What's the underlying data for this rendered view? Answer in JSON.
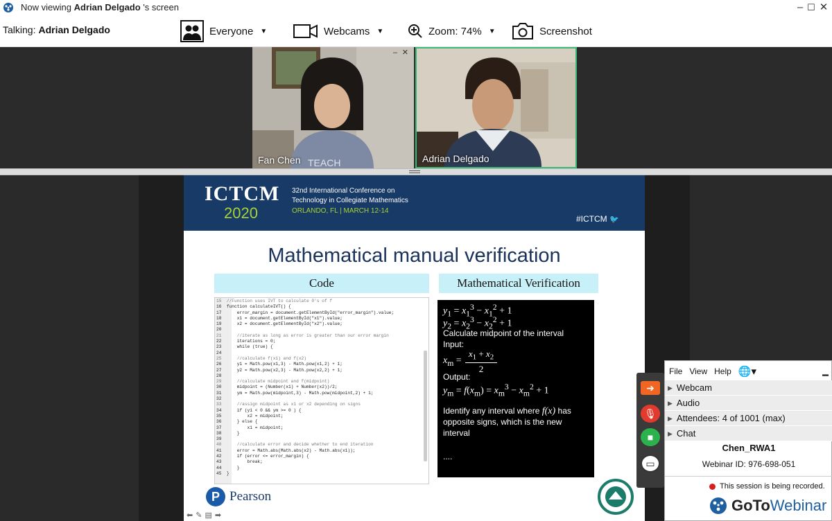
{
  "window": {
    "title_prefix": "Now viewing",
    "presenter": "Adrian Delgado",
    "title_suffix": "'s screen"
  },
  "toolbar": {
    "talking_label": "Talking:",
    "talking_name": "Adrian Delgado",
    "audience_label": "Everyone",
    "webcams_label": "Webcams",
    "zoom_label": "Zoom: 74%",
    "screenshot_label": "Screenshot"
  },
  "webcams": [
    {
      "name": "Fan Chen"
    },
    {
      "name": "Adrian Delgado"
    }
  ],
  "slide": {
    "banner": {
      "brand": "ICTCM",
      "year": "2020",
      "conference_line1": "32nd International Conference on",
      "conference_line2": "Technology in Collegiate Mathematics",
      "location": "ORLANDO, FL | MARCH 12-14",
      "hashtag": "#ICTCM"
    },
    "title": "Mathematical manual verification",
    "code_header": "Code",
    "math_header": "Mathematical Verification",
    "code_lines": [
      "15  //Function uses IVT to calculate 0's of f",
      "16  function calculateIVT() {",
      "17      error_margin = document.getElementById(\"error_margin\").value;",
      "18      x1 = document.getElementById(\"x1\").value;",
      "19      x2 = document.getElementById(\"x2\").value;",
      "20",
      "21      //iterate as long as error is greater than our error margin",
      "22      iterations = 0;",
      "23      while (true) {",
      "24",
      "25      //calculate f(x1) and f(x2)",
      "26      y1 = Math.pow(x1,3) - Math.pow(x1,2) + 1;",
      "27      y2 = Math.pow(x2,3) - Math.pow(x2,2) + 1;",
      "28",
      "29      //calculate midpoint and f(midpoint)",
      "30      midpoint = (Number(x1) + Number(x2))/2;",
      "31      ym = Math.pow(midpoint,3) - Math.pow(midpoint,2) + 1;",
      "32",
      "33      //assign midpoint as x1 or x2 depending on signs",
      "34      if (y1 < 0 && ym >= 0 ) {",
      "35          x2 = midpoint;",
      "36      } else {",
      "37          x1 = midpoint;",
      "38      }",
      "39",
      "40      //calculate error and decide whether to end iteration",
      "41      error = Math.abs(Math.abs(x2) - Math.abs(x1));",
      "42      if (error <= error_margin) {",
      "43          break;",
      "44      }",
      "45  }"
    ],
    "math": {
      "calc_midpoint": "Calculate midpoint of the interval",
      "input_label": "Input:",
      "output_label": "Output:",
      "identify_1": "Identify any interval where",
      "identify_fx": "f(x)",
      "identify_2": "has",
      "identify_3": "opposite signs, which is the new",
      "identify_4": "interval",
      "ellipsis": "...."
    },
    "pearson": "Pearson"
  },
  "panel": {
    "menu": [
      "File",
      "View",
      "Help"
    ],
    "sections": [
      {
        "label": "Webcam"
      },
      {
        "label": "Audio"
      },
      {
        "label": "Attendees:  4 of 1001 (max)"
      },
      {
        "label": "Chat"
      }
    ],
    "user": "Chen_RWA1",
    "webinar_id": "Webinar ID: 976-698-051",
    "recording": "This session is being recorded.",
    "brand_goto": "GoTo",
    "brand_webinar": "Webinar"
  },
  "colors": {
    "banner_navy": "#183a66",
    "banner_green": "#a6d233",
    "header_cyan": "#c8f0f8",
    "active_cam_border": "#3cb878",
    "ctrl_orange": "#f26522",
    "ctrl_red": "#e23b2e",
    "ctrl_green": "#2bb24c",
    "record_red": "#d62020"
  },
  "icons": [
    "app-logo-icon",
    "minimize-icon",
    "maximize-icon",
    "close-icon",
    "people-icon",
    "webcam-icon",
    "zoom-icon",
    "camera-icon",
    "twitter-icon",
    "arrow-right-icon",
    "mic-muted-icon",
    "video-icon",
    "screen-icon",
    "globe-icon",
    "goto-logo-icon"
  ]
}
